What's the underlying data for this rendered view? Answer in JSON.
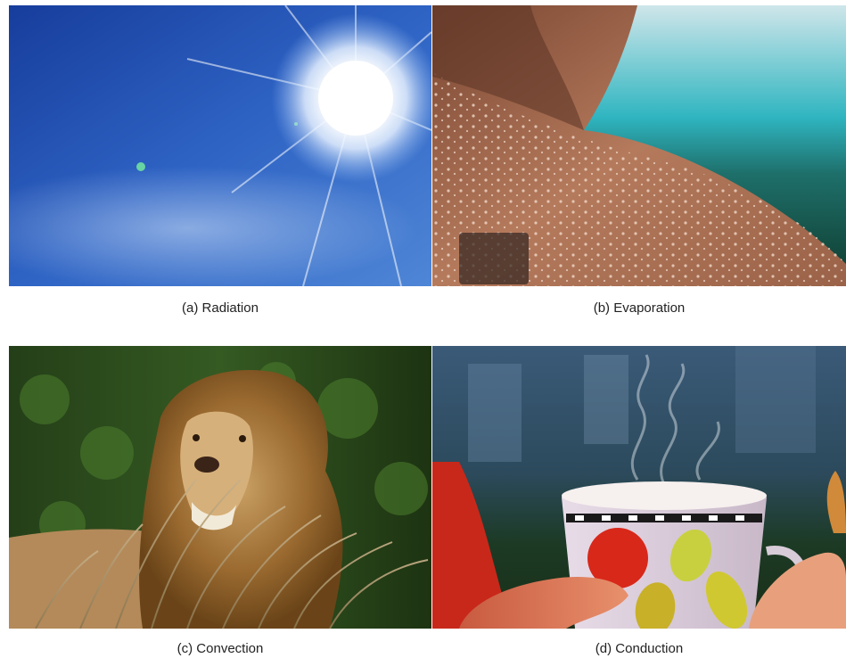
{
  "panels": [
    {
      "id": "a",
      "caption": "(a) Radiation",
      "subject": "sun in blue sky"
    },
    {
      "id": "b",
      "caption": "(b) Evaporation",
      "subject": "sweat droplets on shoulder"
    },
    {
      "id": "c",
      "caption": "(c) Convection",
      "subject": "lion in wind-blown grass"
    },
    {
      "id": "d",
      "caption": "(d) Conduction",
      "subject": "hands holding steaming mug"
    }
  ],
  "colors": {
    "sky": "#1f4fb4",
    "skin": "#b57a5c",
    "pool": "#2fb5c0",
    "foliage": "#2c4a1c",
    "mane": "#9a6a30",
    "mug_red": "#d8281a",
    "background": "#ffffff"
  }
}
